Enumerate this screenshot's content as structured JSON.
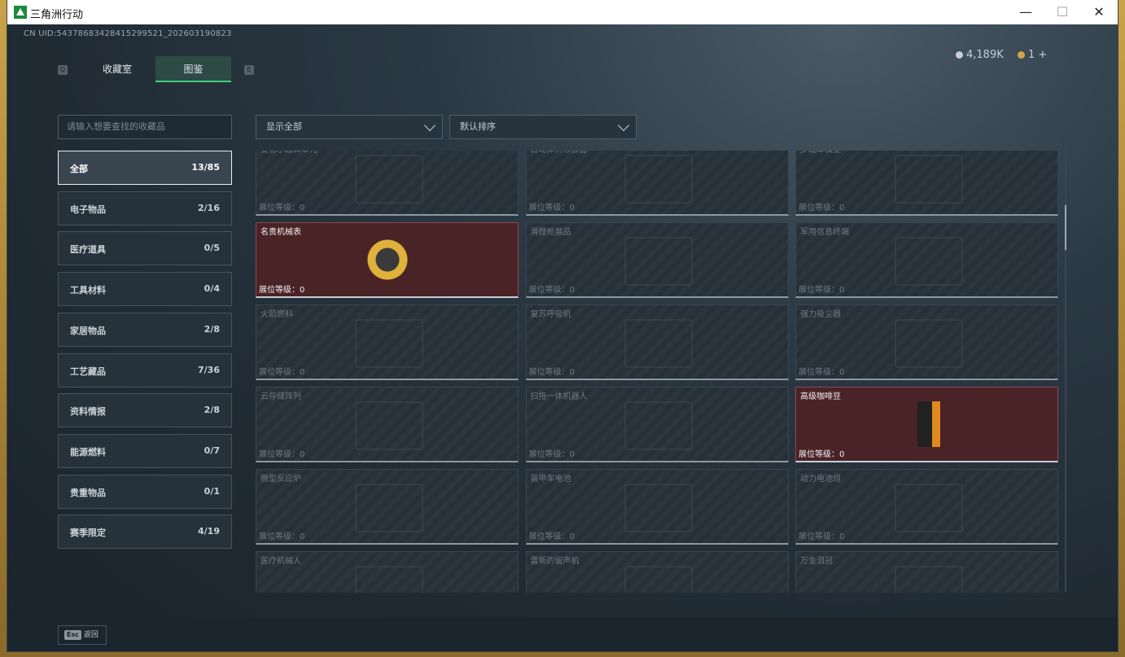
{
  "window": {
    "title": "三角洲行动",
    "minimize": "—",
    "maximize": "☐",
    "close": "✕"
  },
  "header": {
    "uid": "CN UID:543786834284152995​21_202603190823",
    "key_left": "Q",
    "key_right": "E",
    "tabs": [
      {
        "label": "收藏室"
      },
      {
        "label": "图鉴"
      }
    ],
    "currency": [
      {
        "value": "4,189K",
        "color": "#c9ced2"
      },
      {
        "value": "1 +",
        "color": "#d1a64a"
      }
    ]
  },
  "search": {
    "placeholder": "请输入想要查找的收藏品"
  },
  "filters": {
    "show": "显示全部",
    "sort": "默认排序"
  },
  "categories": [
    {
      "label": "全部",
      "count": "13/85"
    },
    {
      "label": "电子物品",
      "count": "2/16"
    },
    {
      "label": "医疗道具",
      "count": "0/5"
    },
    {
      "label": "工具材料",
      "count": "0/4"
    },
    {
      "label": "家居物品",
      "count": "2/8"
    },
    {
      "label": "工艺藏品",
      "count": "7/36"
    },
    {
      "label": "资料情报",
      "count": "2/8"
    },
    {
      "label": "能源燃料",
      "count": "0/7"
    },
    {
      "label": "贵重物品",
      "count": "0/1"
    },
    {
      "label": "赛季限定",
      "count": "4/19"
    }
  ],
  "level_label": "展位等级：0",
  "items": [
    {
      "name": "曼德尔超算单元",
      "owned": false
    },
    {
      "name": "自动体外除颤器",
      "owned": false
    },
    {
      "name": "步战车模型",
      "owned": false
    },
    {
      "name": "名贵机械表",
      "owned": true
    },
    {
      "name": "滑膛枪展品",
      "owned": false
    },
    {
      "name": "军用信息终端",
      "owned": false
    },
    {
      "name": "火箭燃料",
      "owned": false
    },
    {
      "name": "复苏呼吸机",
      "owned": false
    },
    {
      "name": "强力吸尘器",
      "owned": false
    },
    {
      "name": "云存储阵列",
      "owned": false
    },
    {
      "name": "扫拖一体机器人",
      "owned": false
    },
    {
      "name": "高级咖啡豆",
      "owned": true
    },
    {
      "name": "微型反应炉",
      "owned": false
    },
    {
      "name": "装甲车电池",
      "owned": false
    },
    {
      "name": "动力电池组",
      "owned": false
    },
    {
      "name": "医疗机械人",
      "owned": false
    },
    {
      "name": "雷斯的留声机",
      "owned": false
    },
    {
      "name": "万金泪冠",
      "owned": false
    }
  ],
  "footer": {
    "esc_key": "Esc",
    "back": "返回"
  }
}
